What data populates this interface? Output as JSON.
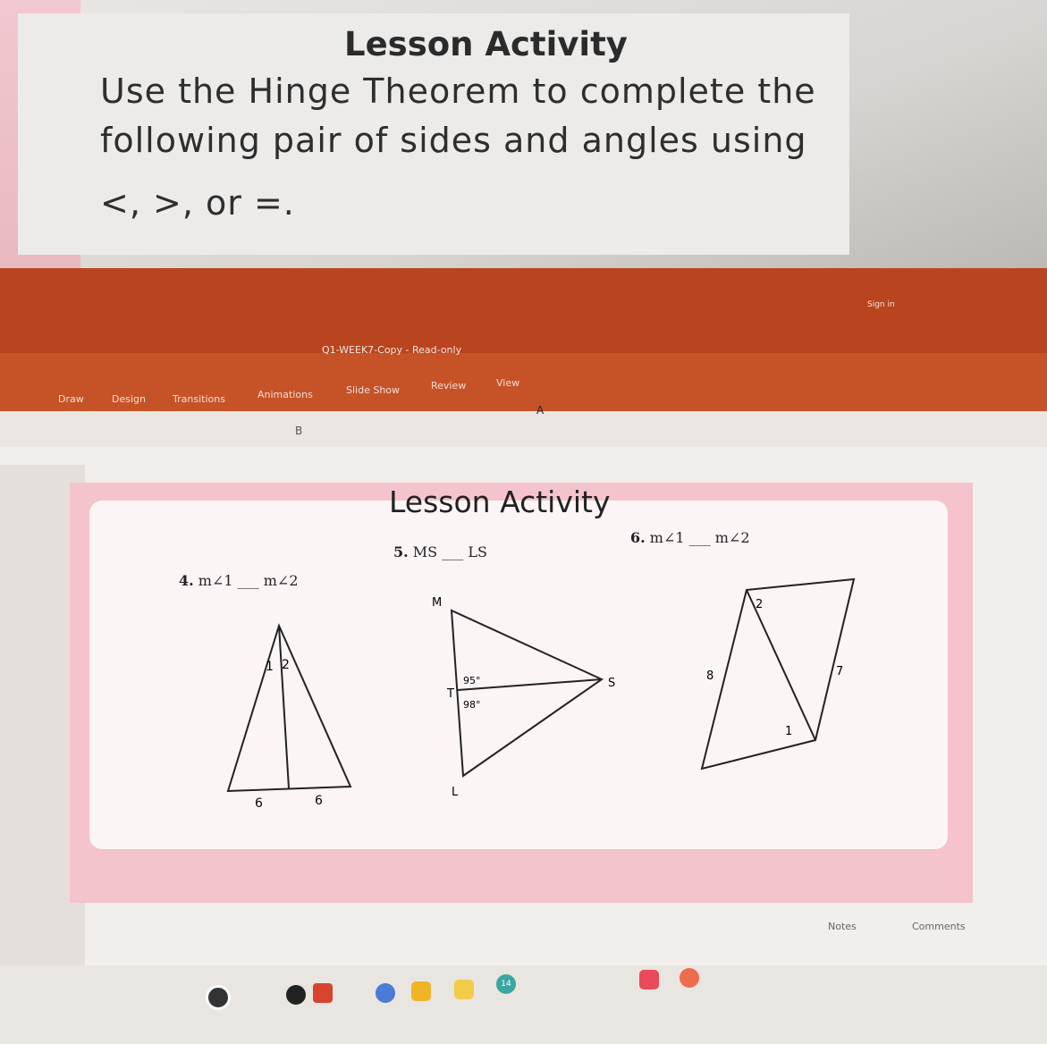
{
  "card": {
    "title": "Lesson Activity",
    "line1": "Use the Hinge Theorem to complete the",
    "line2": "following pair of sides and angles using",
    "line3": "<, >, or =."
  },
  "window": {
    "doc_title": "Q1-WEEK7-Copy - Read-only",
    "sign_in": "Sign in"
  },
  "menu": [
    "Draw",
    "Design",
    "Transitions",
    "Animations",
    "Slide Show",
    "Review",
    "View"
  ],
  "slide": {
    "title": "Lesson Activity",
    "p4": {
      "num": "4.",
      "left": "m∠1",
      "blank": "___",
      "right": "m∠2"
    },
    "p5": {
      "num": "5.",
      "left": "MS",
      "blank": "___",
      "right": "LS"
    },
    "p6": {
      "num": "6.",
      "left": "m∠1",
      "blank": "___",
      "right": "m∠2"
    },
    "fig4": {
      "a1": "1",
      "a2": "2",
      "s1": "6",
      "s2": "6"
    },
    "fig5": {
      "M": "M",
      "T": "T",
      "S": "S",
      "L": "L",
      "ang1": "95°",
      "ang2": "98°"
    },
    "fig6": {
      "a2": "2",
      "s8": "8",
      "s7": "7",
      "a1": "1"
    }
  },
  "status": {
    "notes": "Notes",
    "comments": "Comments"
  },
  "taskbar": {
    "badge": "14"
  },
  "colors": {
    "accent": "#c65327",
    "slide_pink": "#f4c3cc"
  }
}
